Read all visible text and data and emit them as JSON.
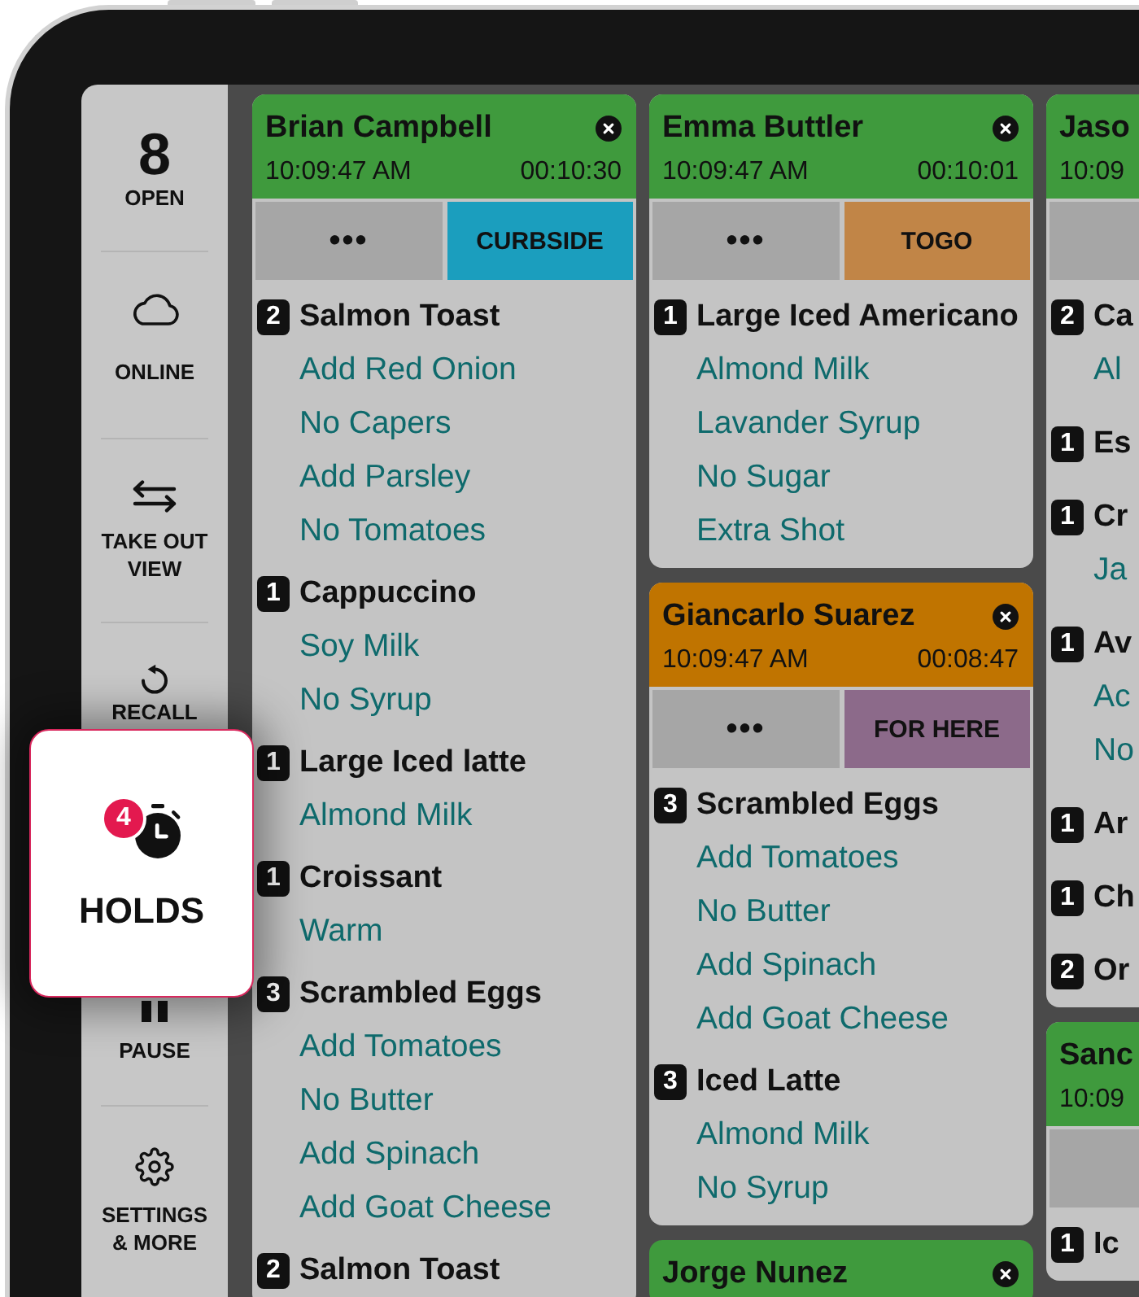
{
  "sidebar": {
    "items": [
      {
        "kind": "count",
        "value": "8",
        "label": "OPEN"
      },
      {
        "kind": "button",
        "label": "ONLINE"
      },
      {
        "kind": "button",
        "label": "TAKE OUT VIEW"
      },
      {
        "kind": "button",
        "label": "RECALL"
      },
      {
        "kind": "highlight",
        "badge": "4",
        "label": "HOLDS"
      },
      {
        "kind": "button",
        "label": "PAUSE"
      },
      {
        "kind": "button",
        "label": "SETTINGS & MORE"
      }
    ]
  },
  "columns": [
    {
      "tickets": [
        {
          "name": "Brian Campbell",
          "closable": true,
          "time": "10:09:47 AM",
          "elapsed": "00:10:30",
          "color": "#3f9a3d",
          "actions": [
            {
              "kind": "more",
              "label": "•••"
            },
            {
              "kind": "tag",
              "label": "CURBSIDE",
              "color": "#1b9ebe"
            }
          ],
          "items": [
            {
              "qty": "2",
              "name": "Salmon Toast",
              "modifiers": [
                "Add Red Onion",
                "No Capers",
                "Add Parsley",
                "No Tomatoes"
              ]
            },
            {
              "qty": "1",
              "name": "Cappuccino",
              "modifiers": [
                "Soy Milk",
                "No Syrup"
              ]
            },
            {
              "qty": "1",
              "name": "Large Iced latte",
              "modifiers": [
                "Almond Milk"
              ]
            },
            {
              "qty": "1",
              "name": "Croissant",
              "modifiers": [
                "Warm"
              ]
            },
            {
              "qty": "3",
              "name": "Scrambled Eggs",
              "modifiers": [
                "Add Tomatoes",
                "No Butter",
                "Add Spinach",
                "Add Goat Cheese"
              ]
            },
            {
              "qty": "2",
              "name": "Salmon Toast"
            }
          ]
        }
      ]
    },
    {
      "tickets": [
        {
          "name": "Emma Buttler",
          "closable": true,
          "time": "10:09:47 AM",
          "elapsed": "00:10:01",
          "color": "#3f9a3d",
          "actions": [
            {
              "kind": "more",
              "label": "•••"
            },
            {
              "kind": "tag",
              "label": "TOGO",
              "color": "#c18547"
            }
          ],
          "items": [
            {
              "qty": "1",
              "name": "Large Iced Americano",
              "modifiers": [
                "Almond Milk",
                "Lavander Syrup",
                "No Sugar",
                "Extra Shot"
              ]
            }
          ]
        },
        {
          "name": "Giancarlo Suarez",
          "closable": true,
          "time": "10:09:47 AM",
          "elapsed": "00:08:47",
          "color": "#c07400",
          "actions": [
            {
              "kind": "more",
              "label": "•••"
            },
            {
              "kind": "tag",
              "label": "FOR HERE",
              "color": "#8c6a8a"
            }
          ],
          "items": [
            {
              "qty": "3",
              "name": "Scrambled Eggs",
              "modifiers": [
                "Add Tomatoes",
                "No Butter",
                "Add Spinach",
                "Add Goat Cheese"
              ]
            },
            {
              "qty": "3",
              "name": "Iced Latte",
              "modifiers": [
                "Almond Milk",
                "No Syrup"
              ]
            }
          ]
        },
        {
          "name": "Jorge Nunez",
          "closable": true,
          "color": "#3f9a3d"
        }
      ]
    },
    {
      "tickets": [
        {
          "name": "Jaso",
          "time": "10:09",
          "color": "#3f9a3d",
          "actions": [
            {
              "kind": "more"
            }
          ],
          "items": [
            {
              "qty": "2",
              "name": "Ca",
              "modifiers": [
                "Al"
              ]
            },
            {
              "qty": "1",
              "name": "Es"
            },
            {
              "qty": "1",
              "name": "Cr",
              "modifiers": [
                "Ja"
              ]
            },
            {
              "qty": "1",
              "name": "Av",
              "modifiers": [
                "Ac",
                "No"
              ]
            },
            {
              "qty": "1",
              "name": "Ar"
            },
            {
              "qty": "1",
              "name": "Ch"
            },
            {
              "qty": "2",
              "name": "Or"
            }
          ]
        },
        {
          "name": "Sanc",
          "time": "10:09",
          "color": "#3f9a3d",
          "actions": [
            {
              "kind": "more"
            }
          ],
          "items": [
            {
              "qty": "1",
              "name": "Ic"
            }
          ]
        }
      ]
    }
  ]
}
